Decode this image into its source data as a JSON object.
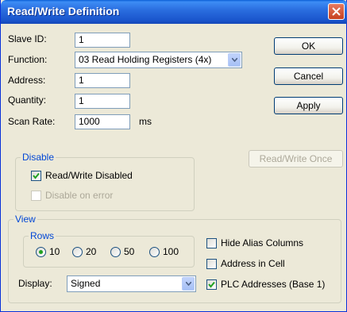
{
  "window": {
    "title": "Read/Write Definition"
  },
  "form": {
    "slave_id_label": "Slave ID:",
    "slave_id_value": "1",
    "function_label": "Function:",
    "function_value": "03 Read Holding Registers (4x)",
    "address_label": "Address:",
    "address_value": "1",
    "quantity_label": "Quantity:",
    "quantity_value": "1",
    "scan_rate_label": "Scan Rate:",
    "scan_rate_value": "1000",
    "scan_rate_unit": "ms"
  },
  "buttons": {
    "ok": "OK",
    "cancel": "Cancel",
    "apply": "Apply",
    "read_write_once": "Read/Write Once"
  },
  "disable_group": {
    "title": "Disable",
    "read_write_disabled": {
      "label": "Read/Write Disabled",
      "checked": true
    },
    "disable_on_error": {
      "label": "Disable on error",
      "checked": false,
      "enabled": false
    }
  },
  "view_group": {
    "title": "View",
    "rows": {
      "title": "Rows",
      "options": [
        "10",
        "20",
        "50",
        "100"
      ],
      "selected": "10"
    },
    "display_label": "Display:",
    "display_value": "Signed",
    "hide_alias_columns": {
      "label": "Hide Alias Columns",
      "checked": false
    },
    "address_in_cell": {
      "label": "Address in Cell",
      "checked": false
    },
    "plc_addresses": {
      "label": "PLC Addresses (Base 1)",
      "checked": true
    }
  },
  "colors": {
    "titlebar": "#1a55cc",
    "dialog_bg": "#ece9d8",
    "group_title": "#0046d5",
    "check_mark": "#21a121"
  }
}
